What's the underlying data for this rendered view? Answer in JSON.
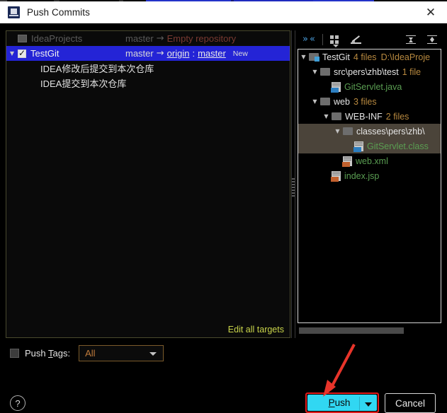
{
  "window": {
    "title": "Push Commits",
    "app_icon": "intellij-idea-icon",
    "close_label": "✕"
  },
  "left_panel": {
    "repositories": [
      {
        "name": "IdeaProjects",
        "checked": false,
        "enabled": false,
        "expander": "",
        "source_branch": "master",
        "arrow": "→",
        "target_text": "Empty repository",
        "target_is_link": false,
        "remote": "",
        "separator": "",
        "target_branch": "",
        "badge": "",
        "selected": false
      },
      {
        "name": "TestGit",
        "checked": true,
        "enabled": true,
        "expander": "▼",
        "source_branch": "master",
        "arrow": "→",
        "target_text": "",
        "target_is_link": true,
        "remote": "origin",
        "separator": ":",
        "target_branch": "master",
        "badge": "New",
        "selected": true
      }
    ],
    "commits": [
      "IDEA修改后提交到本次仓库",
      "IDEA提交到本次仓库"
    ],
    "edit_all_targets": "Edit all targets"
  },
  "right_panel": {
    "toolbar": [
      {
        "name": "show-diff-icon",
        "tooltip": "Show Diff"
      },
      {
        "name": "group-by-icon",
        "tooltip": "Group By"
      },
      {
        "name": "edit-source-icon",
        "tooltip": "Edit Source"
      },
      {
        "name": "expand-all-icon",
        "tooltip": "Expand All"
      },
      {
        "name": "collapse-all-icon",
        "tooltip": "Collapse All"
      }
    ],
    "tree": [
      {
        "indent": 0,
        "expander": "▼",
        "kind": "folder-root",
        "label": "TestGit",
        "count": "4 files",
        "path": "D:\\IdeaProje",
        "selected": false,
        "green": false,
        "filetype": ""
      },
      {
        "indent": 1,
        "expander": "▼",
        "kind": "folder",
        "label": "src\\pers\\zhb\\test",
        "count": "1 file",
        "path": "",
        "selected": false,
        "green": false,
        "filetype": ""
      },
      {
        "indent": 2,
        "expander": "",
        "kind": "file",
        "label": "GitServlet.java",
        "count": "",
        "path": "",
        "selected": false,
        "green": true,
        "filetype": "java"
      },
      {
        "indent": 1,
        "expander": "▼",
        "kind": "folder",
        "label": "web",
        "count": "3 files",
        "path": "",
        "selected": false,
        "green": false,
        "filetype": ""
      },
      {
        "indent": 2,
        "expander": "▼",
        "kind": "folder",
        "label": "WEB-INF",
        "count": "2 files",
        "path": "",
        "selected": false,
        "green": false,
        "filetype": ""
      },
      {
        "indent": 3,
        "expander": "▼",
        "kind": "folder",
        "label": "classes\\pers\\zhb\\",
        "count": "",
        "path": "",
        "selected": true,
        "green": false,
        "filetype": ""
      },
      {
        "indent": 4,
        "expander": "",
        "kind": "file",
        "label": "GitServlet.class",
        "count": "",
        "path": "",
        "selected": true,
        "green": true,
        "filetype": "cls"
      },
      {
        "indent": 3,
        "expander": "",
        "kind": "file",
        "label": "web.xml",
        "count": "",
        "path": "",
        "selected": false,
        "green": true,
        "filetype": "xml"
      },
      {
        "indent": 2,
        "expander": "",
        "kind": "file",
        "label": "index.jsp",
        "count": "",
        "path": "",
        "selected": false,
        "green": true,
        "filetype": "jsp"
      }
    ]
  },
  "bottom": {
    "push_tags_label_pre": "Push ",
    "push_tags_label_key": "T",
    "push_tags_label_post": "ags:",
    "push_tags_checked": false,
    "push_tags_value": "All",
    "help_glyph": "?",
    "push_label_pre": "",
    "push_label_key": "P",
    "push_label_post": "ush",
    "cancel_label": "Cancel"
  },
  "colors": {
    "accent_push": "#31d7f2",
    "annotation_red": "#e01b1b",
    "selection_blue": "#2424d6",
    "selection_brown": "#4b443a",
    "link_yellow": "#c9d44a",
    "file_green": "#5a9e52",
    "count_orange": "#b8893f",
    "select_orange": "#c07b3c"
  }
}
